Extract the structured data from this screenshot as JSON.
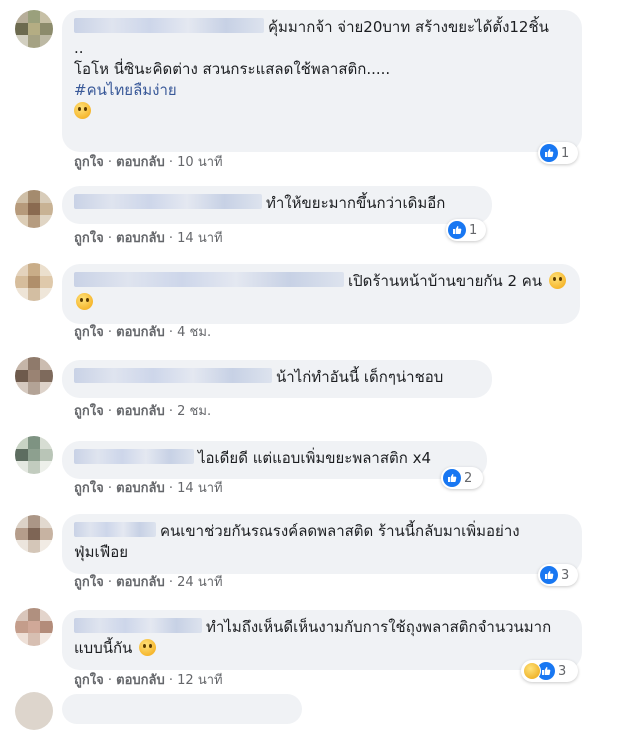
{
  "labels": {
    "like": "ถูกใจ",
    "reply": "ตอบกลับ",
    "sep": "·"
  },
  "comments": [
    {
      "text": "คุ้มมากจ้า จ่าย20บาท สร้างขยะได้ตั้ง12ชิ้น\n..\nโอโห นี่ซินะคิดต่าง สวนกระแสลดใช้พลาสติก.....",
      "hashtag": "#คนไทยลืมง่าย",
      "time": "10 นาที",
      "reactions": "1",
      "reaction_icons": [
        "like-icon"
      ]
    },
    {
      "text": "ทำให้ขยะมากขึ้นกว่าเดิมอีก",
      "time": "14 นาที",
      "reactions": "1",
      "reaction_icons": [
        "like-icon"
      ]
    },
    {
      "text": "เปิดร้านหน้าบ้านขายกัน 2 คน",
      "time": "4 ชม.",
      "reactions": "",
      "reaction_icons": []
    },
    {
      "text": "น้าไก่ทำอันนี้ เด็กๆน่าชอบ",
      "time": "2 ชม.",
      "reactions": "",
      "reaction_icons": []
    },
    {
      "text": "ไอเดียดี แต่แอบเพิ่มขยะพลาสติก x4",
      "time": "14 นาที",
      "reactions": "2",
      "reaction_icons": [
        "like-icon"
      ]
    },
    {
      "text": "คนเขาช่วยกันรณรงค์ลดพลาสติด ร้านนี้กลับมาเพิ่มอย่างฟุ่มเฟือย",
      "time": "24 นาที",
      "reactions": "3",
      "reaction_icons": [
        "like-icon"
      ]
    },
    {
      "text": "ทำไมถึงเห็นดีเห็นงามกับการใช้ถุงพลาสติกจำนวนมากแบบนี้กัน",
      "time": "12 นาที",
      "reactions": "3",
      "reaction_icons": [
        "sad-icon",
        "like-icon"
      ]
    }
  ],
  "colors": {
    "bubble": "#f0f2f5",
    "like_blue": "#1877f2",
    "meta": "#65676b",
    "hashtag": "#385898"
  }
}
